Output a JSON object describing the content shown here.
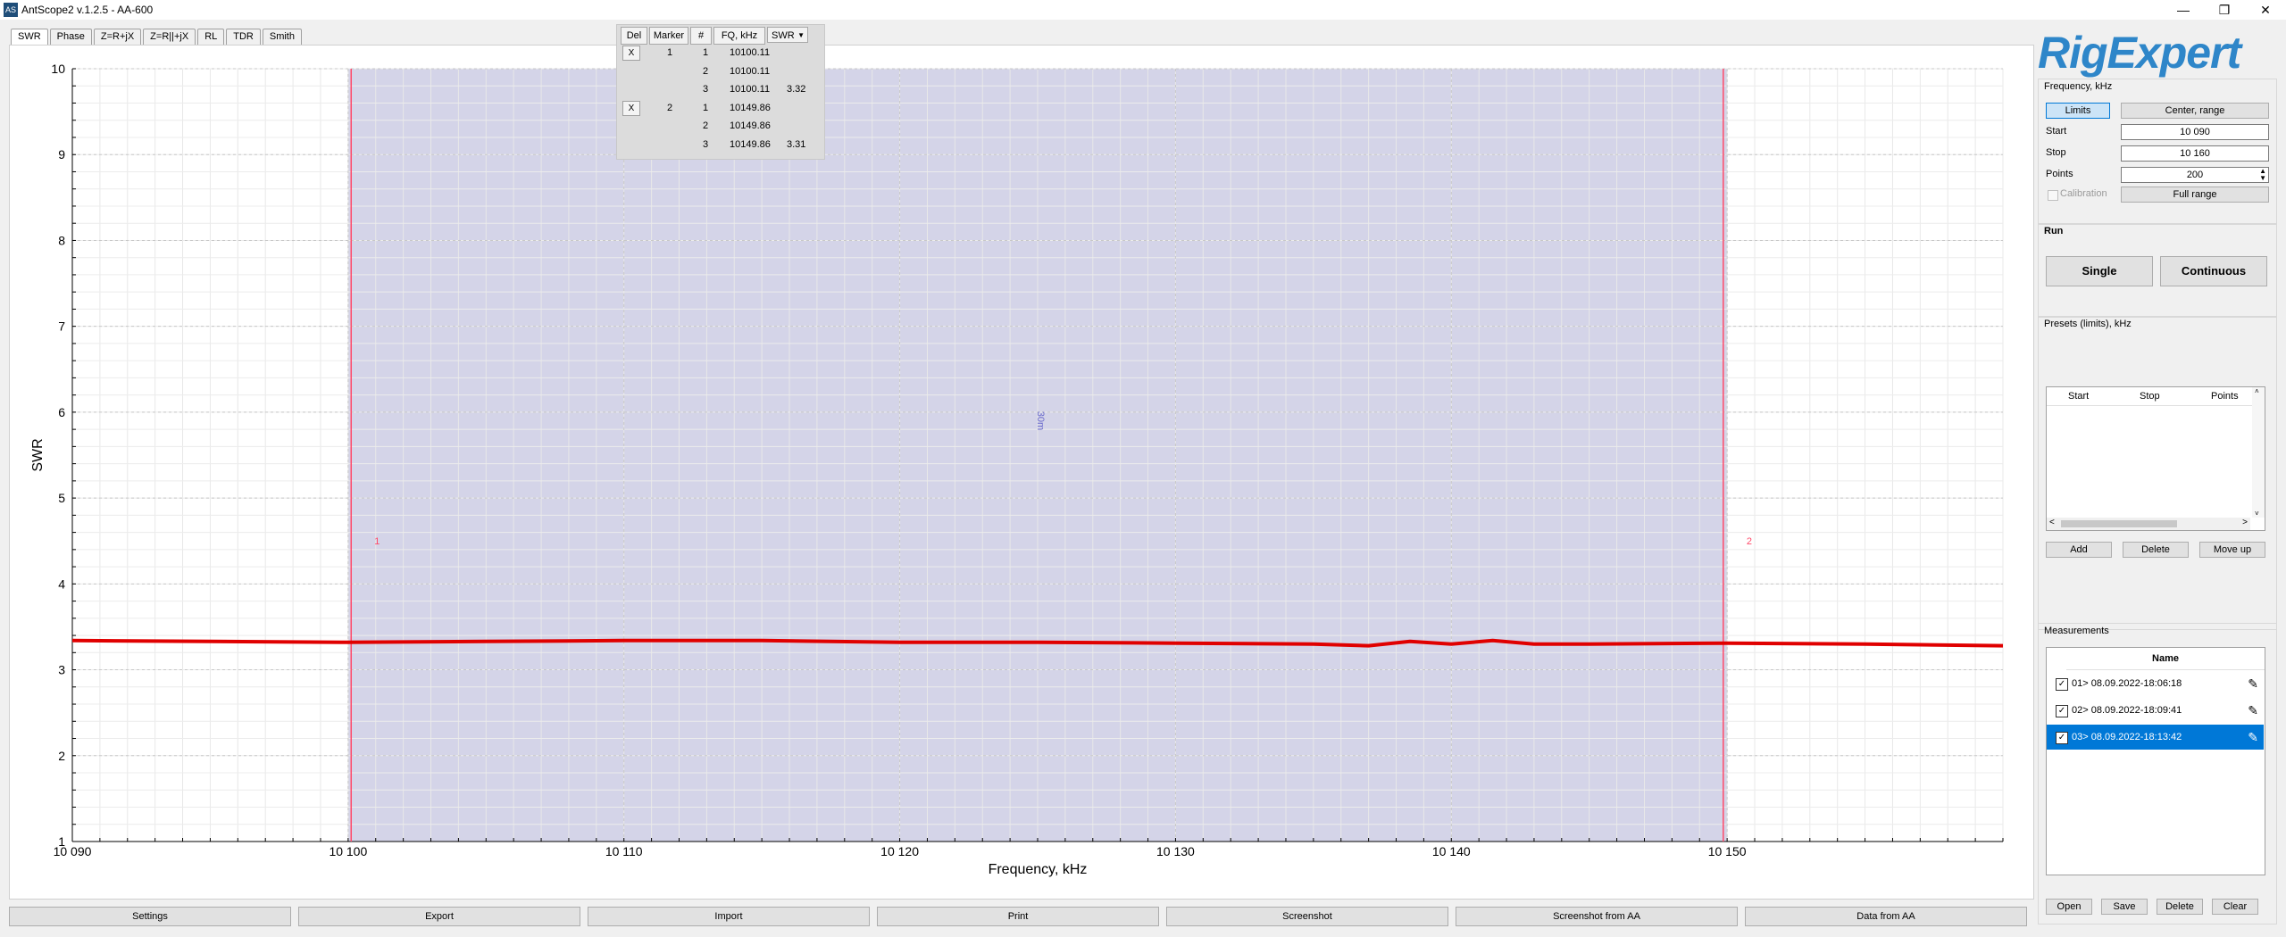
{
  "window": {
    "title": "AntScope2 v.1.2.5 - AA-600",
    "minimize": "—",
    "maximize": "❐",
    "close": "✕"
  },
  "tabs": [
    {
      "label": "SWR",
      "active": true
    },
    {
      "label": "Phase"
    },
    {
      "label": "Z=R+jX"
    },
    {
      "label": "Z=R||+jX"
    },
    {
      "label": "RL"
    },
    {
      "label": "TDR"
    },
    {
      "label": "Smith"
    }
  ],
  "marker_table": {
    "headers": [
      "Del",
      "Marker",
      "#",
      "FQ, kHz",
      "SWR"
    ],
    "delete_label": "X",
    "rows": [
      {
        "del": true,
        "marker": "1",
        "n": "1",
        "fq": "10100.11",
        "swr": ""
      },
      {
        "del": false,
        "marker": "",
        "n": "2",
        "fq": "10100.11",
        "swr": ""
      },
      {
        "del": false,
        "marker": "",
        "n": "3",
        "fq": "10100.11",
        "swr": "3.32"
      },
      {
        "del": true,
        "marker": "2",
        "n": "1",
        "fq": "10149.86",
        "swr": ""
      },
      {
        "del": false,
        "marker": "",
        "n": "2",
        "fq": "10149.86",
        "swr": ""
      },
      {
        "del": false,
        "marker": "",
        "n": "3",
        "fq": "10149.86",
        "swr": "3.31"
      }
    ]
  },
  "chart_data": {
    "type": "line",
    "xlabel": "Frequency, kHz",
    "ylabel": "SWR",
    "xlim": [
      10090,
      10160
    ],
    "ylim": [
      1,
      10
    ],
    "x_ticks": [
      "10 090",
      "10 100",
      "10 110",
      "10 120",
      "10 130",
      "10 140",
      "10 150"
    ],
    "x_tick_values": [
      10090,
      10100,
      10110,
      10120,
      10130,
      10140,
      10150
    ],
    "y_ticks": [
      1,
      2,
      3,
      4,
      5,
      6,
      7,
      8,
      9,
      10
    ],
    "band": {
      "label": "30m",
      "from": 10100,
      "to": 10150,
      "color": "#b8b8d8"
    },
    "markers": [
      {
        "label": "1",
        "x": 10100.11
      },
      {
        "label": "2",
        "x": 10149.86
      }
    ],
    "series": [
      {
        "color": "#e00000",
        "x": [
          10090,
          10095,
          10100,
          10105,
          10110,
          10115,
          10120,
          10125,
          10130,
          10135,
          10137,
          10138.5,
          10140,
          10141.5,
          10143,
          10145,
          10150,
          10155,
          10160
        ],
        "y": [
          3.34,
          3.33,
          3.32,
          3.33,
          3.34,
          3.34,
          3.32,
          3.32,
          3.31,
          3.3,
          3.28,
          3.33,
          3.3,
          3.34,
          3.3,
          3.3,
          3.31,
          3.3,
          3.28
        ]
      }
    ]
  },
  "right_panel": {
    "logo": "RigExpert",
    "frequency_group": {
      "title": "Frequency, kHz",
      "limits_label": "Limits",
      "center_range_label": "Center, range",
      "start_label": "Start",
      "start_value": "10 090",
      "stop_label": "Stop",
      "stop_value": "10 160",
      "points_label": "Points",
      "points_value": "200",
      "calibration_label": "Calibration",
      "full_range_label": "Full range"
    },
    "run_group": {
      "title": "Run",
      "single_label": "Single",
      "continuous_label": "Continuous"
    },
    "presets_group": {
      "title": "Presets (limits), kHz",
      "columns": [
        "Start",
        "Stop",
        "Points"
      ],
      "add_label": "Add",
      "delete_label": "Delete",
      "move_up_label": "Move up"
    },
    "measurements_group": {
      "title": "Measurements",
      "column": "Name",
      "items": [
        {
          "name": "01> 08.09.2022-18:06:18",
          "checked": true,
          "selected": false
        },
        {
          "name": "02> 08.09.2022-18:09:41",
          "checked": true,
          "selected": false
        },
        {
          "name": "03> 08.09.2022-18:13:42",
          "checked": true,
          "selected": true
        }
      ],
      "open_label": "Open",
      "save_label": "Save",
      "delete_label": "Delete",
      "clear_label": "Clear"
    }
  },
  "bottom_buttons": [
    "Settings",
    "Export",
    "Import",
    "Print",
    "Screenshot",
    "Screenshot from AA",
    "Data from AA"
  ]
}
